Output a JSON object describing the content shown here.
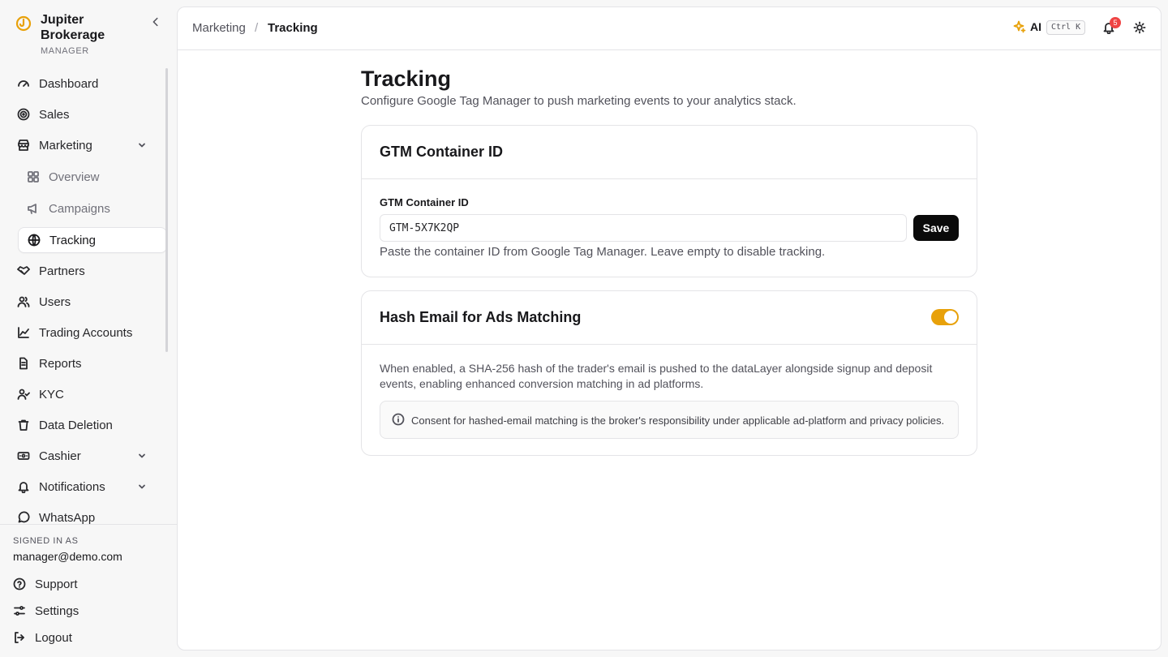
{
  "brand": {
    "name": "Jupiter Brokerage",
    "role": "MANAGER",
    "accent": "#e8a10a"
  },
  "nav": {
    "items": [
      {
        "label": "Dashboard"
      },
      {
        "label": "Sales"
      },
      {
        "label": "Marketing"
      },
      {
        "label": "Overview"
      },
      {
        "label": "Campaigns"
      },
      {
        "label": "Tracking"
      },
      {
        "label": "Partners"
      },
      {
        "label": "Users"
      },
      {
        "label": "Trading Accounts"
      },
      {
        "label": "Reports"
      },
      {
        "label": "KYC"
      },
      {
        "label": "Data Deletion"
      },
      {
        "label": "Cashier"
      },
      {
        "label": "Notifications"
      },
      {
        "label": "WhatsApp"
      }
    ],
    "active": "Tracking"
  },
  "footer": {
    "signed_in_label": "SIGNED IN AS",
    "email": "manager@demo.com",
    "support": "Support",
    "settings": "Settings",
    "logout": "Logout"
  },
  "topbar": {
    "breadcrumb": [
      "Marketing",
      "Tracking"
    ],
    "separator": "/",
    "ai_label": "AI",
    "shortcut": "Ctrl K",
    "notification_count": "5"
  },
  "page": {
    "title": "Tracking",
    "subtitle": "Configure Google Tag Manager to push marketing events to your analytics stack."
  },
  "gtm_card": {
    "title": "GTM Container ID",
    "field_label": "GTM Container ID",
    "field_value": "GTM-5X7K2QP",
    "save_label": "Save",
    "help": "Paste the container ID from Google Tag Manager. Leave empty to disable tracking."
  },
  "hash_card": {
    "title": "Hash Email for Ads Matching",
    "enabled": true,
    "description": "When enabled, a SHA-256 hash of the trader's email is pushed to the dataLayer alongside signup and deposit events, enabling enhanced conversion matching in ad platforms.",
    "notice": "Consent for hashed-email matching is the broker's responsibility under applicable ad-platform and privacy policies."
  }
}
